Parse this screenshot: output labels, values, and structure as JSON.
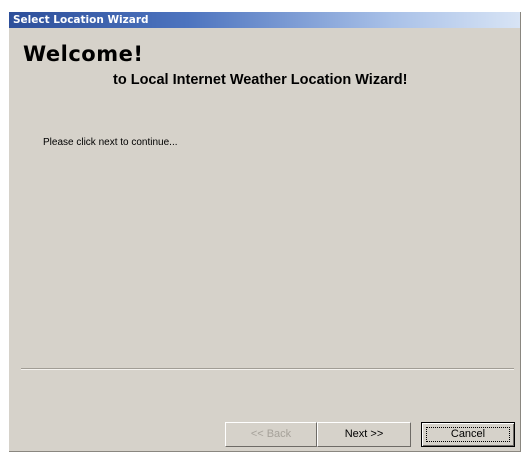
{
  "window": {
    "title": "Select Location Wizard"
  },
  "content": {
    "heading": "Welcome!",
    "subheading": "to Local Internet Weather Location Wizard!",
    "instruction": "Please click next to continue..."
  },
  "buttons": {
    "back": {
      "label": "<< Back",
      "enabled": false
    },
    "next": {
      "label": "Next >>",
      "enabled": true
    },
    "cancel": {
      "label": "Cancel",
      "enabled": true,
      "focused": true
    }
  },
  "colors": {
    "titlebar_start": "#2d4f9a",
    "titlebar_end": "#d8e4f5",
    "window_bg": "#d6d2ca",
    "disabled_text": "#a6a29a"
  }
}
